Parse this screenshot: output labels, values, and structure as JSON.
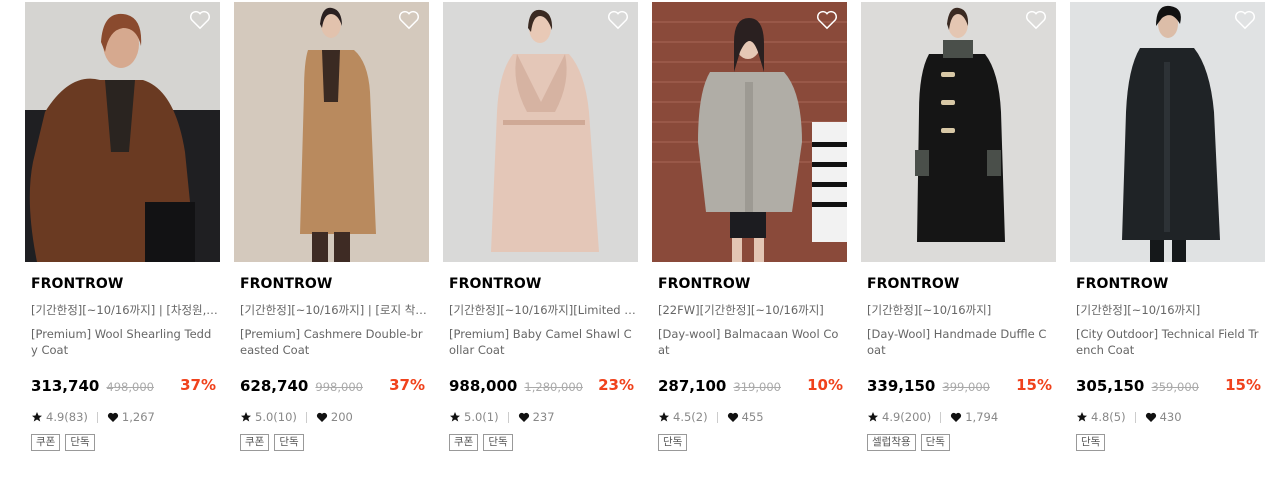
{
  "products": [
    {
      "brand": "FRONTROW",
      "promo": "[기간한정][~10/16까지] | [차정원,정...",
      "name": "[Premium] Wool Shearling Teddy Coat",
      "price": "313,740",
      "original_price": "498,000",
      "discount": "37%",
      "rating": "4.9(83)",
      "likes": "1,267",
      "tags": [
        "쿠폰",
        "단독"
      ]
    },
    {
      "brand": "FRONTROW",
      "promo": "[기간한정][~10/16까지] | [로지 착용][...",
      "name": "[Premium] Cashmere Double-breasted Coat",
      "price": "628,740",
      "original_price": "998,000",
      "discount": "37%",
      "rating": "5.0(10)",
      "likes": "200",
      "tags": [
        "쿠폰",
        "단독"
      ]
    },
    {
      "brand": "FRONTROW",
      "promo": "[기간한정][~10/16까지][Limited Edit...",
      "name": "[Premium] Baby Camel Shawl Collar Coat",
      "price": "988,000",
      "original_price": "1,280,000",
      "discount": "23%",
      "rating": "5.0(1)",
      "likes": "237",
      "tags": [
        "쿠폰",
        "단독"
      ]
    },
    {
      "brand": "FRONTROW",
      "promo": "[22FW][기간한정][~10/16까지]",
      "name": "[Day-wool] Balmacaan Wool Coat",
      "price": "287,100",
      "original_price": "319,000",
      "discount": "10%",
      "rating": "4.5(2)",
      "likes": "455",
      "tags": [
        "단독"
      ]
    },
    {
      "brand": "FRONTROW",
      "promo": "[기간한정][~10/16까지]",
      "name": "[Day-Wool] Handmade Duffle Coat",
      "price": "339,150",
      "original_price": "399,000",
      "discount": "15%",
      "rating": "4.9(200)",
      "likes": "1,794",
      "tags": [
        "셀럽착용",
        "단독"
      ]
    },
    {
      "brand": "FRONTROW",
      "promo": "[기간한정][~10/16까지]",
      "name": "[City Outdoor] Technical Field Trench Coat",
      "price": "305,150",
      "original_price": "359,000",
      "discount": "15%",
      "rating": "4.8(5)",
      "likes": "430",
      "tags": [
        "단독"
      ]
    }
  ],
  "colors": {
    "discount": "#f0421c",
    "meta_text": "#888888",
    "name_text": "#666666"
  },
  "icons": {
    "wishlist": "heart-outline-icon",
    "rating": "star-icon",
    "likes": "heart-filled-icon"
  }
}
